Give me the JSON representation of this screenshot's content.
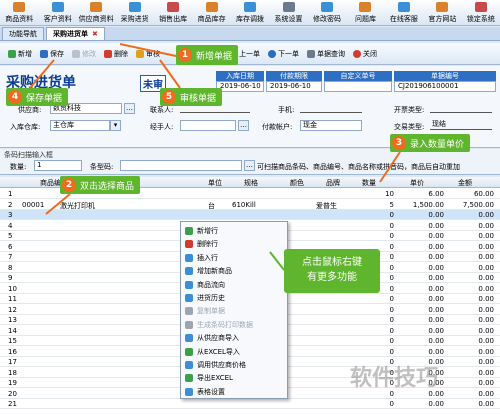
{
  "menubar": {
    "items": [
      {
        "label": "商品资料",
        "icon": "product-icon",
        "color": "#d9822b"
      },
      {
        "label": "客户资料",
        "icon": "customer-icon",
        "color": "#3a8fd6"
      },
      {
        "label": "供应商资料",
        "icon": "supplier-icon",
        "color": "#d9822b"
      },
      {
        "label": "采购进货",
        "icon": "purchase-icon",
        "color": "#3a8fd6"
      },
      {
        "label": "销售出库",
        "icon": "sales-icon",
        "color": "#c84b4b"
      },
      {
        "label": "商品库存",
        "icon": "stock-icon",
        "color": "#d9822b"
      },
      {
        "label": "库存调拨",
        "icon": "transfer-icon",
        "color": "#3a8fd6"
      },
      {
        "label": "系统设置",
        "icon": "settings-icon",
        "color": "#6b7a8c"
      },
      {
        "label": "修改密码",
        "icon": "password-icon",
        "color": "#3a8fd6"
      },
      {
        "label": "问题库",
        "icon": "question-icon",
        "color": "#d9822b"
      },
      {
        "label": "在线客服",
        "icon": "service-icon",
        "color": "#3a8fd6"
      },
      {
        "label": "官方网站",
        "icon": "website-icon",
        "color": "#d9822b"
      },
      {
        "label": "锁定系统",
        "icon": "lock-icon",
        "color": "#c84b4b"
      }
    ]
  },
  "tabs": [
    {
      "label": "功能导航",
      "active": false
    },
    {
      "label": "采购进货单",
      "active": true
    }
  ],
  "toolbar": {
    "new": "新增",
    "save": "保存",
    "modify": "修改",
    "delete": "删除",
    "audit": "审核",
    "prev": "上一单",
    "next": "下一单",
    "query": "单据查询",
    "close": "关闭"
  },
  "header": {
    "title": "采购进货单",
    "subtitle": "未审",
    "info_headers": [
      "入库日期",
      "付款期限",
      "自定义单号",
      "单据编号"
    ],
    "info_values": [
      "2019-06-10",
      "2019-06-10",
      "",
      "CJ201906100001"
    ],
    "supplier_label": "供应商:",
    "supplier_value": "数贸科技",
    "contact_label": "联系人:",
    "phone_label": "手机:",
    "invoice_label": "开票类型:",
    "warehouse_label": "入库仓库:",
    "warehouse_value": "主仓库",
    "handler_label": "经手人:",
    "account_label": "付款帐户:",
    "account_value": "现金",
    "trade_label": "交易类型:",
    "trade_value": "现结"
  },
  "scan": {
    "title": "条码扫描输入框",
    "qty_label": "数量:",
    "qty_value": "1",
    "barcode_label": "条型码:",
    "note": "可扫描商品条码、商品编号、商品名称或拼音码，商品后自动重加"
  },
  "grid": {
    "columns": [
      "商品编号",
      "单位",
      "规格",
      "颜色",
      "品牌",
      "数量",
      "单价",
      "金额"
    ],
    "rows": [
      {
        "no": "1",
        "code": "",
        "name": "",
        "unit": "",
        "spec": "",
        "color": "",
        "brand": "",
        "qty": "10",
        "price": "6.00",
        "amount": "60.00"
      },
      {
        "no": "2",
        "code": "00001",
        "name": "激光打印机",
        "unit": "台",
        "spec": "610Kill",
        "color": "",
        "brand": "爱普生",
        "qty": "5",
        "price": "1,500.00",
        "amount": "7,500.00"
      },
      {
        "no": "3",
        "code": "",
        "name": "",
        "unit": "",
        "spec": "",
        "color": "",
        "brand": "",
        "qty": "0",
        "price": "0.00",
        "amount": "0.00"
      },
      {
        "no": "4",
        "code": "",
        "name": "",
        "unit": "",
        "spec": "",
        "color": "",
        "brand": "",
        "qty": "0",
        "price": "0.00",
        "amount": "0.00"
      },
      {
        "no": "5",
        "code": "",
        "name": "",
        "unit": "",
        "spec": "",
        "color": "",
        "brand": "",
        "qty": "0",
        "price": "0.00",
        "amount": "0.00"
      },
      {
        "no": "6",
        "code": "",
        "name": "",
        "unit": "",
        "spec": "",
        "color": "",
        "brand": "",
        "qty": "0",
        "price": "0.00",
        "amount": "0.00"
      },
      {
        "no": "7",
        "code": "",
        "name": "",
        "unit": "",
        "spec": "",
        "color": "",
        "brand": "",
        "qty": "0",
        "price": "0.00",
        "amount": "0.00"
      },
      {
        "no": "8",
        "code": "",
        "name": "",
        "unit": "",
        "spec": "",
        "color": "",
        "brand": "",
        "qty": "0",
        "price": "0.00",
        "amount": "0.00"
      },
      {
        "no": "9",
        "code": "",
        "name": "",
        "unit": "",
        "spec": "",
        "color": "",
        "brand": "",
        "qty": "0",
        "price": "0.00",
        "amount": "0.00"
      },
      {
        "no": "10",
        "code": "",
        "name": "",
        "unit": "",
        "spec": "",
        "color": "",
        "brand": "",
        "qty": "0",
        "price": "0.00",
        "amount": "0.00"
      },
      {
        "no": "11",
        "code": "",
        "name": "",
        "unit": "",
        "spec": "",
        "color": "",
        "brand": "",
        "qty": "0",
        "price": "0.00",
        "amount": "0.00"
      },
      {
        "no": "12",
        "code": "",
        "name": "",
        "unit": "",
        "spec": "",
        "color": "",
        "brand": "",
        "qty": "0",
        "price": "0.00",
        "amount": "0.00"
      },
      {
        "no": "13",
        "code": "",
        "name": "",
        "unit": "",
        "spec": "",
        "color": "",
        "brand": "",
        "qty": "0",
        "price": "0.00",
        "amount": "0.00"
      },
      {
        "no": "14",
        "code": "",
        "name": "",
        "unit": "",
        "spec": "",
        "color": "",
        "brand": "",
        "qty": "0",
        "price": "0.00",
        "amount": "0.00"
      },
      {
        "no": "15",
        "code": "",
        "name": "",
        "unit": "",
        "spec": "",
        "color": "",
        "brand": "",
        "qty": "0",
        "price": "0.00",
        "amount": "0.00"
      },
      {
        "no": "16",
        "code": "",
        "name": "",
        "unit": "",
        "spec": "",
        "color": "",
        "brand": "",
        "qty": "0",
        "price": "0.00",
        "amount": "0.00"
      },
      {
        "no": "17",
        "code": "",
        "name": "",
        "unit": "",
        "spec": "",
        "color": "",
        "brand": "",
        "qty": "0",
        "price": "0.00",
        "amount": "0.00"
      },
      {
        "no": "18",
        "code": "",
        "name": "",
        "unit": "",
        "spec": "",
        "color": "",
        "brand": "",
        "qty": "0",
        "price": "0.00",
        "amount": "0.00"
      },
      {
        "no": "19",
        "code": "",
        "name": "",
        "unit": "",
        "spec": "",
        "color": "",
        "brand": "",
        "qty": "0",
        "price": "0.00",
        "amount": "0.00"
      },
      {
        "no": "20",
        "code": "",
        "name": "",
        "unit": "",
        "spec": "",
        "color": "",
        "brand": "",
        "qty": "0",
        "price": "0.00",
        "amount": "0.00"
      },
      {
        "no": "21",
        "code": "",
        "name": "",
        "unit": "",
        "spec": "",
        "color": "",
        "brand": "",
        "qty": "0",
        "price": "0.00",
        "amount": "0.00"
      }
    ]
  },
  "context_menu": {
    "items": [
      {
        "label": "新增行",
        "icon": "add-row-icon",
        "color": "#3aa04a",
        "disabled": false
      },
      {
        "label": "删除行",
        "icon": "delete-row-icon",
        "color": "#d43b2b",
        "disabled": false
      },
      {
        "label": "插入行",
        "icon": "insert-row-icon",
        "color": "#3a8fd6",
        "disabled": false
      },
      {
        "label": "增加新商品",
        "icon": "new-product-icon",
        "color": "#3a8fd6",
        "disabled": false
      },
      {
        "label": "商品流向",
        "icon": "product-flow-icon",
        "color": "#3a8fd6",
        "disabled": false
      },
      {
        "label": "进货历史",
        "icon": "history-icon",
        "color": "#3a8fd6",
        "disabled": false
      },
      {
        "label": "复制单据",
        "icon": "copy-icon",
        "color": "#9ca6b3",
        "disabled": true
      },
      {
        "label": "生成条码打印数据",
        "icon": "barcode-icon",
        "color": "#9ca6b3",
        "disabled": true
      },
      {
        "label": "从供应商导入",
        "icon": "supplier-import-icon",
        "color": "#3a8fd6",
        "disabled": false
      },
      {
        "label": "从EXCEL导入",
        "icon": "excel-import-icon",
        "color": "#3aa04a",
        "disabled": false
      },
      {
        "label": "调用供应商价格",
        "icon": "supplier-price-icon",
        "color": "#3a8fd6",
        "disabled": false
      },
      {
        "label": "导出EXCEL",
        "icon": "excel-export-icon",
        "color": "#3aa04a",
        "disabled": false
      },
      {
        "label": "表格设置",
        "icon": "table-settings-icon",
        "color": "#3a8fd6",
        "disabled": false
      }
    ]
  },
  "callouts": {
    "c1": {
      "num": "1",
      "text": "新增单据"
    },
    "c2": {
      "num": "2",
      "text": "双击选择商品"
    },
    "c3": {
      "num": "3",
      "text": "录入数量单价"
    },
    "c4": {
      "num": "4",
      "text": "保存单据"
    },
    "c5": {
      "num": "5",
      "text": "审核单据"
    },
    "tip_line1": "点击鼠标右键",
    "tip_line2": "有更多功能"
  },
  "watermark": "软件技巧"
}
